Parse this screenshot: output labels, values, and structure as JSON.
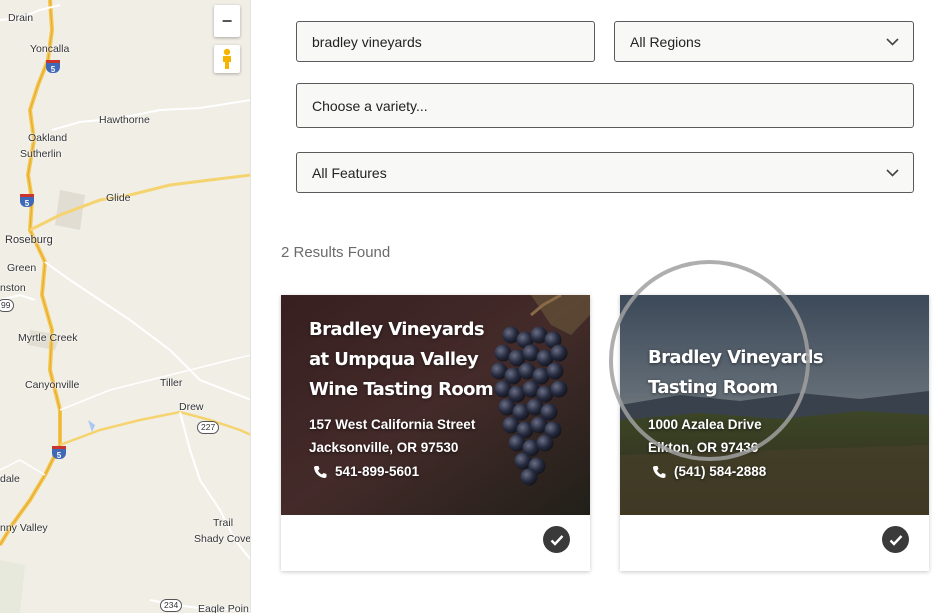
{
  "map": {
    "labels": {
      "drain": "Drain",
      "yoncalla": "Yoncalla",
      "hawthorne": "Hawthorne",
      "oakland": "Oakland",
      "sutherlin": "Sutherlin",
      "glide": "Glide",
      "roseburg": "Roseburg",
      "green": "Green",
      "nston": "nston",
      "myrtle_creek": "Myrtle Creek",
      "canyonville": "Canyonville",
      "tiller": "Tiller",
      "drew": "Drew",
      "dale": "dale",
      "nny_valley": "nny Valley",
      "trail": "Trail",
      "shady_cove": "Shady Cove",
      "eagle_point": "Eagle Poin"
    },
    "shields": {
      "i5_a": "5",
      "i5_b": "5",
      "i5_c": "5",
      "r99": "99",
      "r227": "227",
      "r234": "234"
    },
    "zoom_out_label": "−"
  },
  "filters": {
    "search_value": "bradley vineyards",
    "region_selected": "All Regions",
    "variety_placeholder": "Choose a variety...",
    "features_selected": "All Features"
  },
  "results_count": "2 Results Found",
  "results": [
    {
      "title": "Bradley Vineyards at Umpqua Valley Wine Tasting Room",
      "address_line1": "157 West California Street",
      "address_line2": "Jacksonville, OR 97530",
      "phone": "541-899-5601"
    },
    {
      "title": "Bradley Vineyards Tasting Room",
      "address_line1": "1000 Azalea Drive",
      "address_line2": "Elkton, OR 97436",
      "phone": "(541) 584-2888"
    }
  ],
  "colors": {
    "map_background": "#f1eee6",
    "highway": "#f5c64a",
    "interstate_shield": "#3f68b6",
    "field_border": "#5a5a5a",
    "check_button": "#3a3a3a"
  },
  "icons": {
    "zoom_out": "minus-icon",
    "street_view": "pegman-icon",
    "dropdown": "chevron-down-icon",
    "phone": "phone-icon",
    "check": "check-icon"
  }
}
